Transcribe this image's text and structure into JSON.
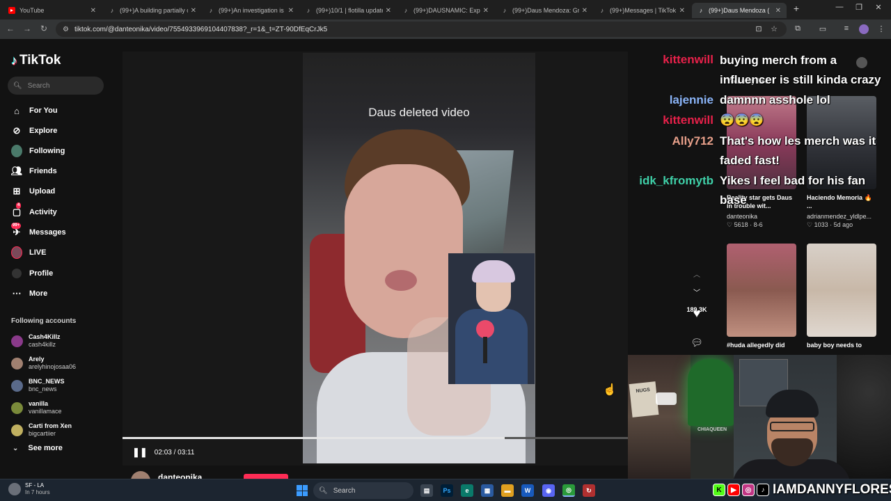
{
  "browser": {
    "tabs": [
      {
        "title": "YouTube",
        "active": false
      },
      {
        "title": "(99+)A building partially c",
        "active": false
      },
      {
        "title": "(99+)An investigation is u",
        "active": false
      },
      {
        "title": "(99+)10/1 | flotilla update",
        "active": false
      },
      {
        "title": "(99+)DAUSNAMIC: Explor",
        "active": false
      },
      {
        "title": "(99+)Daus Mendoza: Grov",
        "active": false
      },
      {
        "title": "(99+)Messages | TikTok",
        "active": false
      },
      {
        "title": "(99+)Daus Mendoza (",
        "active": true
      }
    ],
    "new_tab_label": "+",
    "url": "tiktok.com/@danteonika/video/7554933969104407838?_r=1&_t=ZT-90DfEqCrJk5"
  },
  "sidebar": {
    "brand": "TikTok",
    "search_placeholder": "Search",
    "nav": [
      {
        "label": "For You",
        "icon": "home-icon"
      },
      {
        "label": "Explore",
        "icon": "compass-icon"
      },
      {
        "label": "Following",
        "icon": "following-avatar-icon"
      },
      {
        "label": "Friends",
        "icon": "friends-icon"
      },
      {
        "label": "Upload",
        "icon": "upload-icon"
      },
      {
        "label": "Activity",
        "icon": "activity-icon",
        "badge": "4"
      },
      {
        "label": "Messages",
        "icon": "messages-icon",
        "badge": "99+"
      },
      {
        "label": "LIVE",
        "icon": "live-icon"
      },
      {
        "label": "Profile",
        "icon": "profile-icon"
      },
      {
        "label": "More",
        "icon": "more-icon"
      }
    ],
    "following_title": "Following accounts",
    "accounts": [
      {
        "name": "Cash4Killz",
        "handle": "cash4killz",
        "color": "#8a3a8a"
      },
      {
        "name": "Arely",
        "handle": "arelyhinojosaa06",
        "color": "#a08070"
      },
      {
        "name": "BNC_NEWS",
        "handle": "bnc_news",
        "color": "#5a6a8a"
      },
      {
        "name": "vanilla",
        "handle": "vanillamace",
        "color": "#7a8a3a"
      },
      {
        "name": "Carti from Xen",
        "handle": "bigcartiier",
        "color": "#c0b060"
      }
    ],
    "see_more": "See more"
  },
  "video": {
    "caption": "Daus deleted video",
    "time": "02:03 / 03:11",
    "progress": 0.756,
    "likes": "189.3K",
    "author": "danteonika"
  },
  "chat": {
    "names": [
      {
        "name": "kittenwill",
        "color": "#e8214a"
      },
      {
        "name": "lajennie",
        "color": "#8ab4f8"
      },
      {
        "name": "kittenwill",
        "color": "#e8214a"
      },
      {
        "name": "Ally712",
        "color": "#e8a08a"
      },
      {
        "name": "idk_kfromytb",
        "color": "#3fd0a8"
      }
    ],
    "lines": [
      "buying merch from a",
      "influencer is still kinda crazy",
      "damnnn asshole lol",
      "😨😨😨",
      "That's how les merch was it",
      "faded fast!",
      "Yikes I feel bad for his fan",
      "base"
    ]
  },
  "recommendations": {
    "heading": "You may like",
    "cards": [
      {
        "title": "Reality star gets Daus in trouble wit...",
        "author": "danteonika",
        "likes": "5618",
        "date": "8-6"
      },
      {
        "title": "Haciendo Memoria 🔥 ...",
        "author": "adrianmendez_yldlpe...",
        "likes": "1033",
        "date": "5d ago"
      },
      {
        "title": "#huda allegedly did",
        "author": "",
        "likes": "",
        "date": ""
      },
      {
        "title": "baby boy needs to",
        "author": "",
        "likes": "",
        "date": ""
      }
    ]
  },
  "stream": {
    "handle": "IAMDANNYFLORES",
    "socials": [
      {
        "label": "K",
        "bg": "#53fc18",
        "fg": "#000"
      },
      {
        "label": "▶",
        "bg": "#ff0000",
        "fg": "#fff"
      },
      {
        "label": "◎",
        "bg": "#c13584",
        "fg": "#fff"
      },
      {
        "label": "♪",
        "bg": "#000",
        "fg": "#fff"
      }
    ],
    "webcam_signs": [
      "NUGS",
      "CHIAQUEEN"
    ]
  },
  "taskbar": {
    "weather_title": "SF - LA",
    "weather_sub": "In 7 hours",
    "search_label": "Search",
    "apps": [
      {
        "label": "▤",
        "bg": "#3a4450"
      },
      {
        "label": "Ps",
        "bg": "#001e36"
      },
      {
        "label": "e",
        "bg": "#0a7a6a"
      },
      {
        "label": "▦",
        "bg": "#2a5aa0"
      },
      {
        "label": "▬",
        "bg": "#e0a020"
      },
      {
        "label": "W",
        "bg": "#185abd"
      },
      {
        "label": "◉",
        "bg": "#5865f2"
      },
      {
        "label": "◎",
        "bg": "#2a9a3a"
      },
      {
        "label": "↻",
        "bg": "#b03030"
      }
    ]
  }
}
